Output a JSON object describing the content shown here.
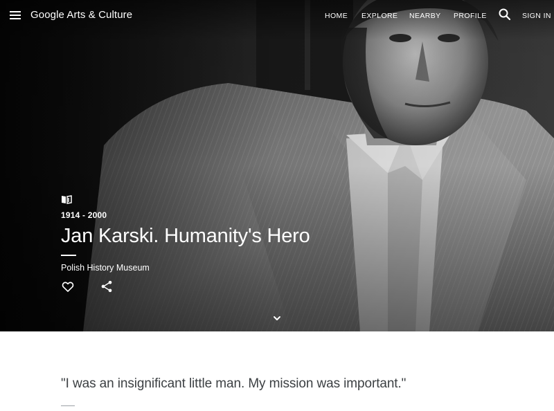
{
  "header": {
    "brand": "Google Arts & Culture",
    "nav": {
      "home": "HOME",
      "explore": "EXPLORE",
      "nearby": "NEARBY",
      "profile": "PROFILE",
      "sign_in": "SIGN IN"
    }
  },
  "hero": {
    "dates": "1914 - 2000",
    "title": "Jan Karski. Humanity's Hero",
    "partner": "Polish History Museum"
  },
  "article": {
    "quote": "\"I was an insignificant little man. My mission was important.\""
  },
  "icons": {
    "menu": "menu-icon",
    "search": "search-icon",
    "story": "story-book-icon",
    "like": "heart-outline-icon",
    "share": "share-icon",
    "scroll": "chevron-down-icon"
  },
  "colors": {
    "hero_text": "#ffffff",
    "quote_text": "#3c4043",
    "page_background": "#ffffff"
  }
}
